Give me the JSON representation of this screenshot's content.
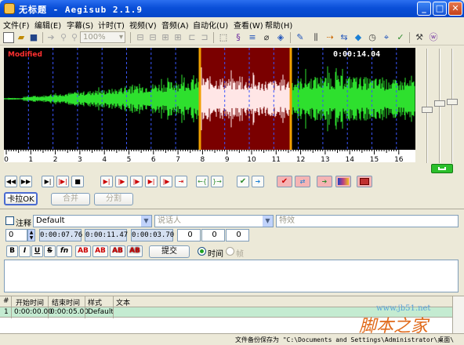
{
  "title": "无标题 - Aegisub 2.1.9",
  "menu": [
    "文件(F)",
    "编辑(E)",
    "字幕(S)",
    "计时(T)",
    "视频(V)",
    "音频(A)",
    "自动化(U)",
    "查看(W)",
    "帮助(H)"
  ],
  "toolbar": {
    "zoom": "100%"
  },
  "audio": {
    "modified_label": "Modified",
    "time_display": "0:00:14.04",
    "timeline_ticks": [
      "0",
      "1",
      "2",
      "3",
      "4",
      "5",
      "6",
      "7",
      "8",
      "9",
      "10",
      "11",
      "12",
      "13",
      "14",
      "15",
      "16"
    ],
    "colors": {
      "waveform": "#2ee02e",
      "selection_bg": "#7a0000",
      "selection_wave": "#ffe6e6",
      "boundary": "#f0a000"
    }
  },
  "buttons": {
    "karaoke": "卡拉OK",
    "join": "合并",
    "split": "分割",
    "commit": "提交"
  },
  "edit": {
    "comment_label": "注释",
    "style_value": "Default",
    "actor_placeholder": "说话人",
    "effect_placeholder": "特效",
    "layer": "0",
    "start_time": "0:00:07.76",
    "end_time": "0:00:11.47",
    "duration": "0:00:03.70",
    "margin_l": "0",
    "margin_r": "0",
    "margin_v": "0",
    "format_buttons": [
      "B",
      "I",
      "U",
      "S",
      "fn",
      "AB",
      "AB",
      "AB",
      "AB"
    ],
    "time_radio": "时间",
    "frame_radio": "帧"
  },
  "grid": {
    "headers": [
      "#",
      "开始时间",
      "结束时间",
      "样式",
      "文本"
    ],
    "rows": [
      {
        "num": "1",
        "start": "0:00:00.00",
        "end": "0:00:05.00",
        "style": "Default",
        "text": ""
      }
    ]
  },
  "status": "文件备份保存为 \"C:\\Documents and Settings\\Administrator\\桌面\\",
  "watermark": {
    "site": "www.jb51.net",
    "brand": "脚本之家"
  }
}
